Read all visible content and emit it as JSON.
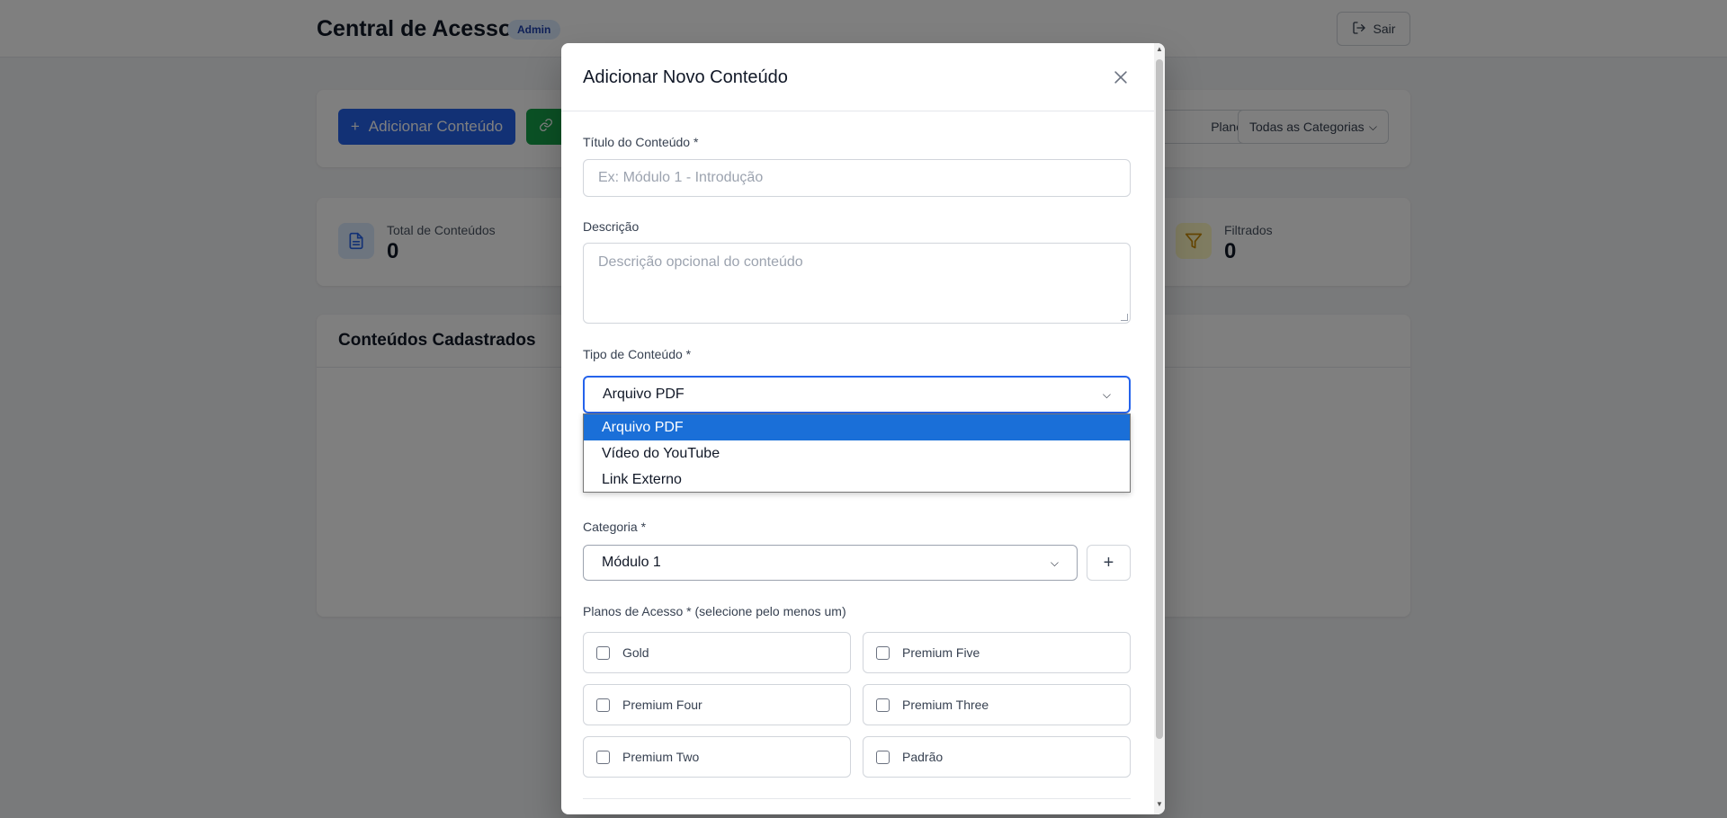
{
  "header": {
    "title": "Central de Acesso",
    "badge": "Admin",
    "logout_label": "Sair"
  },
  "actions": {
    "add_content_label": "Adicionar Conteúdo",
    "plans_filter_label": "Planos",
    "category_filter_label": "Todas as Categorias"
  },
  "stats": [
    {
      "label": "Total de Conteúdos",
      "value": "0"
    },
    {
      "label": "Filtrados",
      "value": "0"
    }
  ],
  "list": {
    "title": "Conteúdos Cadastrados"
  },
  "modal": {
    "title": "Adicionar Novo Conteúdo",
    "fields": {
      "title_label": "Título do Conteúdo *",
      "title_placeholder": "Ex: Módulo 1 - Introdução",
      "description_label": "Descrição",
      "description_placeholder": "Descrição opcional do conteúdo",
      "type_label": "Tipo de Conteúdo *",
      "type_value": "Arquivo PDF",
      "type_options": [
        "Arquivo PDF",
        "Vídeo do YouTube",
        "Link Externo"
      ],
      "category_label": "Categoria *",
      "category_value": "Módulo 1",
      "add_category_label": "+",
      "plans_label": "Planos de Acesso * (selecione pelo menos um)",
      "plans": [
        "Gold",
        "Premium Five",
        "Premium Four",
        "Premium Three",
        "Premium Two",
        "Padrão"
      ]
    }
  },
  "colors": {
    "primary": "#2563eb",
    "success": "#16a34a",
    "warning": "#eab308",
    "selected_option": "#1a6fd8"
  }
}
